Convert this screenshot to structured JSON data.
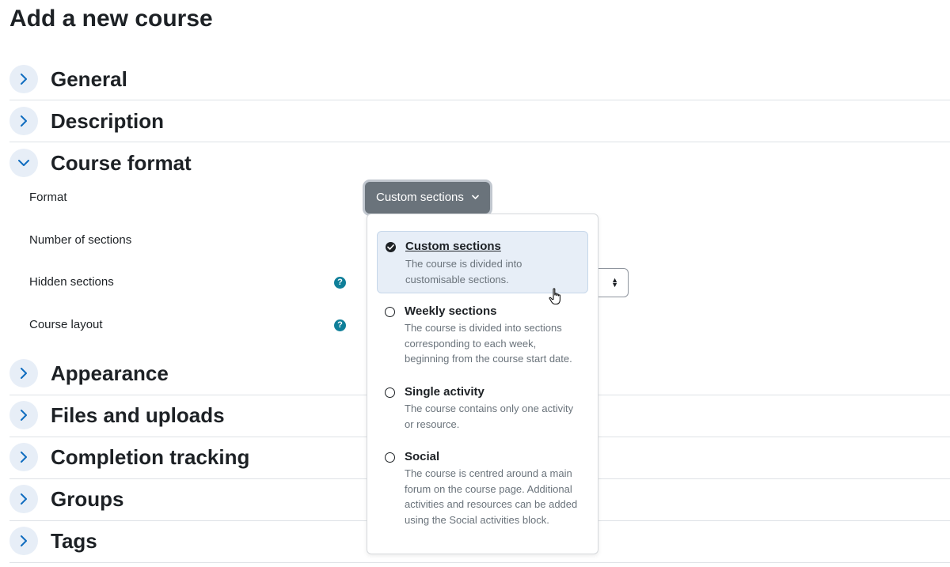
{
  "page": {
    "title": "Add a new course"
  },
  "sections": {
    "general": "General",
    "description": "Description",
    "course_format": "Course format",
    "appearance": "Appearance",
    "files_uploads": "Files and uploads",
    "completion_tracking": "Completion tracking",
    "groups": "Groups",
    "tags": "Tags"
  },
  "course_format": {
    "fields": {
      "format": "Format",
      "number_of_sections": "Number of sections",
      "hidden_sections": "Hidden sections",
      "course_layout": "Course layout"
    },
    "help_icon_glyph": "?",
    "format_button_label": "Custom sections"
  },
  "format_menu": {
    "options": [
      {
        "title": "Custom sections",
        "description": "The course is divided into customisable sections.",
        "selected": true
      },
      {
        "title": "Weekly sections",
        "description": "The course is divided into sections corresponding to each week, beginning from the course start date.",
        "selected": false
      },
      {
        "title": "Single activity",
        "description": "The course contains only one activity or resource.",
        "selected": false
      },
      {
        "title": "Social",
        "description": "The course is centred around a main forum on the course page. Additional activities and resources can be added using the Social activities block.",
        "selected": false
      }
    ]
  },
  "icons": {
    "expand": "chevron-right-icon",
    "collapse": "chevron-down-icon",
    "help": "question-circle-icon",
    "selected": "check-circle-icon",
    "select": "sort-updown-icon",
    "cursor": "hand-pointer-icon"
  },
  "colors": {
    "accent": "#0f6cbf",
    "toggle_bg": "#e7eef7",
    "help_icon": "#0f7f99",
    "button_bg": "#6a737b",
    "muted_text": "#6a737b"
  }
}
